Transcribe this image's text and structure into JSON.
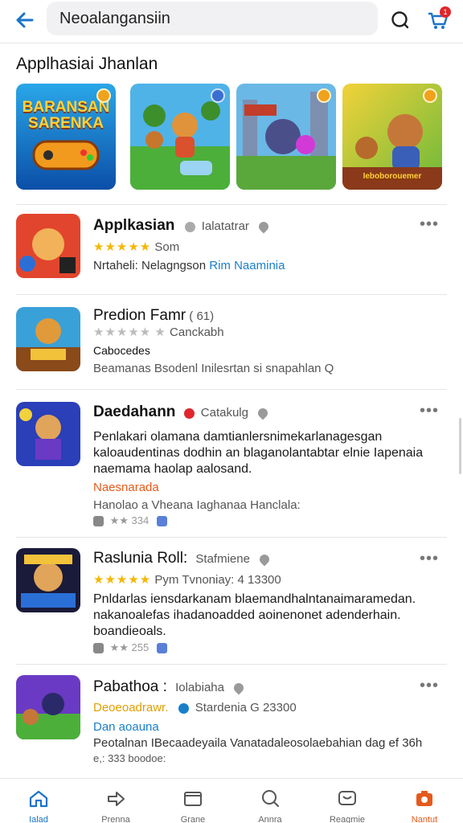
{
  "header": {
    "search_value": "Neoalangansiin"
  },
  "section": {
    "title": "Applhasiai Jhanlan"
  },
  "featured": [
    {
      "caption": "BARANSAN SARENKA"
    },
    {
      "caption": ""
    },
    {
      "caption": ""
    },
    {
      "caption": "Ieboborouemer"
    }
  ],
  "items": [
    {
      "title": "Applkasian",
      "publisher": "Ialatatrar",
      "rating_stars": "★★★★★",
      "rating_text": "Som",
      "meta": "Nrtaheli: Nelagngson",
      "meta_link": "Rim Naaminia"
    },
    {
      "title": "Predion Famr",
      "title_suffix": "( 61)",
      "rating_stars": "★★★★★",
      "rating_text": "Canckabh",
      "subtitle": "Cabocedes",
      "meta": "Beamanas Bsodenl Inilesrtan si snapahlan Q"
    },
    {
      "title": "Daedahann",
      "publisher": "Catakulg",
      "description": "Penlakari olamana damtianlersnimekarlanagesgan kaloaudentinas dodhin an blaganolantabtar elnie Iapenaia naemama haolap aalosand.",
      "tag": "Naesnarada",
      "meta": "Hanolao a Vheana Iaghanaa Hanclala:",
      "stats": "★★ 334"
    },
    {
      "title": "Raslunia Roll:",
      "publisher": "Stafmiene",
      "rating_stars": "★★★★★",
      "rating_text": "Pym Tvnoniay: 4 13300",
      "description": "Pnldarlas iensdarkanam blaemandhalntanaimaramedan. nakanoalefas ihadanoadded aoinenonet adenderhain. boandieoals.",
      "stats": "★★ 255"
    },
    {
      "title": "Pabathoa :",
      "publisher": "Iolabiaha",
      "rating_text_gold": "Deoeoadrawr.",
      "rating_text": "Stardenia G 23300",
      "tag": "Dan aoauna",
      "meta": "Peotalnan IBecaadeyaila Vanatadaleosolaebahian dag ef 36h",
      "meta2": "e,: 333 boodoe:"
    }
  ],
  "nav": [
    {
      "label": "Ialad"
    },
    {
      "label": "Prenna"
    },
    {
      "label": "Grane"
    },
    {
      "label": "Annra"
    },
    {
      "label": "Reagmie"
    },
    {
      "label": "Nantut"
    }
  ],
  "colors": {
    "accent": "#1a73c9",
    "star": "#f5b700",
    "badge": "#e0262b",
    "highlight": "#e55a1a"
  }
}
